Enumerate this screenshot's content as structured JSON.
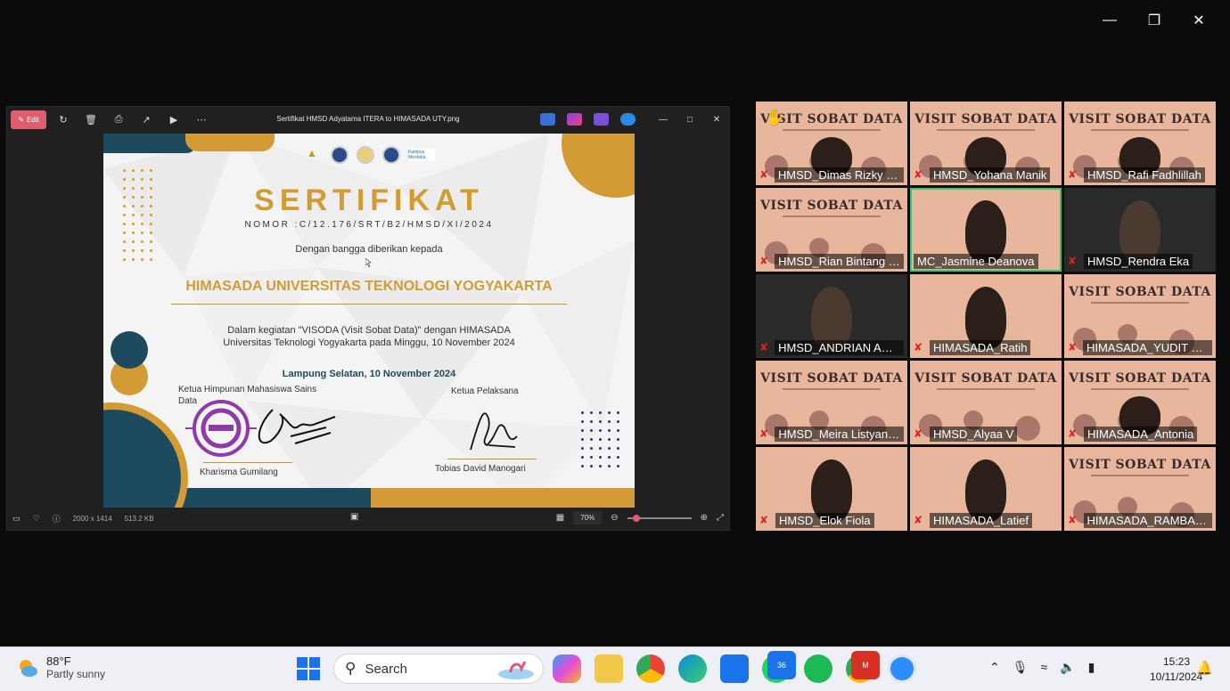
{
  "viewer": {
    "edit_label": "Edit",
    "file_title": "Sertifikat HMSD Adyatama ITERA to HIMASADA UTY.png",
    "dimensions": "2000 x 1414",
    "file_size": "513.2 KB",
    "zoom": "70%"
  },
  "certificate": {
    "title": "SERTIFIKAT",
    "number": "NOMOR :C/12.176/SRT/B2/HMSD/XI/2024",
    "given_to": "Dengan bangga diberikan kepada",
    "recipient": "HIMASADA UNIVERSITAS TEKNOLOGI YOGYAKARTA",
    "desc_line1": "Dalam kegiatan \"VISODA (Visit Sobat Data)\" dengan HIMASADA",
    "desc_line2": "Universitas Teknologi Yogyakarta pada Minggu, 10 November 2024",
    "place_date": "Lampung Selatan, 10 November 2024",
    "sig1_title": "Ketua Himpunan Mahasiswa Sains Data",
    "sig1_name": "Kharisma Gumilang",
    "sig2_title": "Ketua Pelaksana",
    "sig2_name": "Tobias David Manogari",
    "logo_text": "Kampus Merdeka",
    "logo_itera": "ITERA"
  },
  "gallery": {
    "banner": "VISIT SOBAT DATA",
    "participants": [
      {
        "name": "HMSD_Dimas Rizky Ra...",
        "video": "banner-face"
      },
      {
        "name": "HMSD_Yohana Manik",
        "video": "banner-face"
      },
      {
        "name": "HMSD_Rafi Fadhlillah",
        "video": "banner-face"
      },
      {
        "name": "HMSD_Rian Bintang W...",
        "video": "banner"
      },
      {
        "name": "MC_Jasmine Deanova",
        "video": "face",
        "active": true
      },
      {
        "name": "HMSD_Rendra Eka",
        "video": "dark-face"
      },
      {
        "name": "HMSD_ANDRIAN AGU...",
        "video": "dark-face"
      },
      {
        "name": "HIMASADA_Ratih",
        "video": "face"
      },
      {
        "name": "HIMASADA_YUDIT MA...",
        "video": "banner"
      },
      {
        "name": "HMSD_Meira Listyanin...",
        "video": "banner"
      },
      {
        "name": "HMSD_Alyaa V",
        "video": "banner"
      },
      {
        "name": "HIMASADA_Antonia",
        "video": "banner-face"
      },
      {
        "name": "HMSD_Elok Fiola",
        "video": "face"
      },
      {
        "name": "HIMASADA_Latief",
        "video": "face"
      },
      {
        "name": "HIMASADA_RAMBAN...",
        "video": "banner"
      }
    ]
  },
  "taskbar": {
    "temp": "88°F",
    "weather": "Partly sunny",
    "search_placeholder": "Search",
    "whatsapp_badge": "36",
    "chrome_badge": "M",
    "time": "15:23",
    "date": "10/11/2024"
  },
  "colors": {
    "gold": "#d39b35",
    "navy": "#1e4a5e",
    "edit": "#e05d6f",
    "active_speaker": "#2ecc71"
  }
}
